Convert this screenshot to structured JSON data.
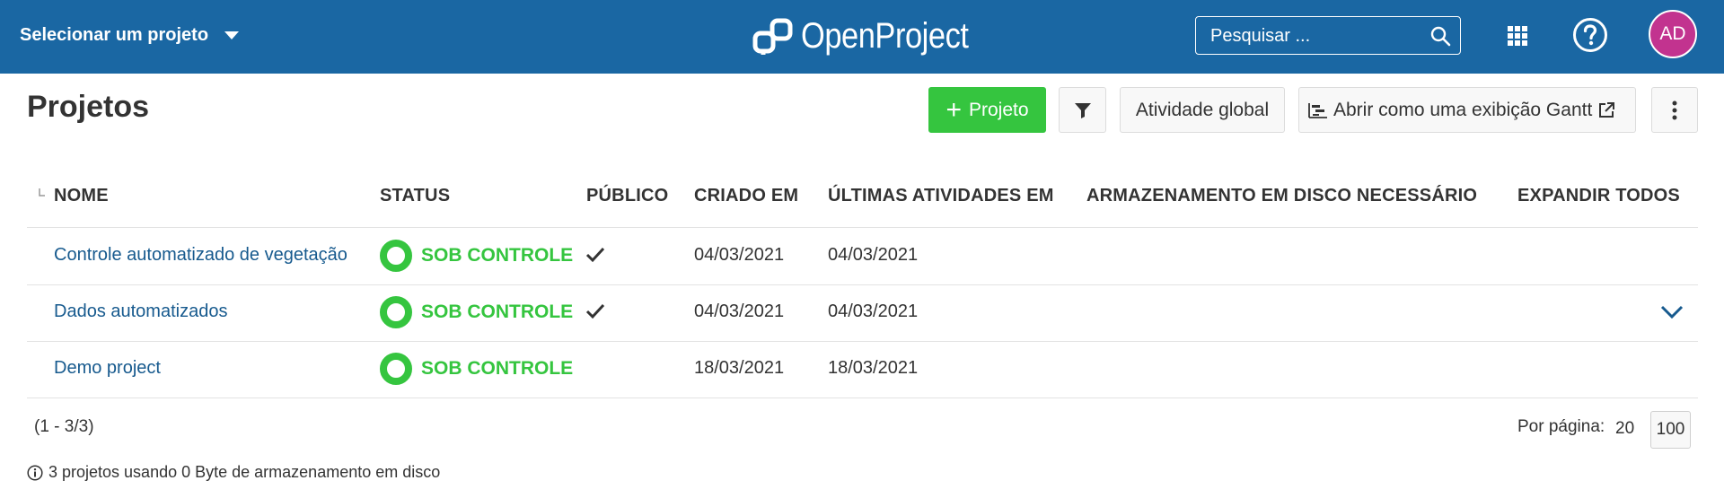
{
  "header": {
    "project_selector": "Selecionar um projeto",
    "logo_text": "OpenProject",
    "search_placeholder": "Pesquisar ...",
    "avatar_initials": "AD",
    "avatar_color": "#c2338f",
    "bar_color": "#1a67a3"
  },
  "page": {
    "title": "Projetos"
  },
  "toolbar": {
    "new_project_label": "Projeto",
    "activity_label": "Atividade global",
    "gantt_label": "Abrir como uma exibição Gantt",
    "accent_color": "#35c53f"
  },
  "table": {
    "columns": [
      "NOME",
      "STATUS",
      "PÚBLICO",
      "CRIADO EM",
      "ÚLTIMAS ATIVIDADES EM",
      "ARMAZENAMENTO EM DISCO NECESSÁRIO",
      "EXPANDIR TODOS"
    ],
    "rows": [
      {
        "name": "Controle automatizado de vegetação",
        "status": "SOB CONTROLE",
        "public": true,
        "created": "04/03/2021",
        "last_activity": "04/03/2021",
        "expandable": false
      },
      {
        "name": "Dados automatizados",
        "status": "SOB CONTROLE",
        "public": true,
        "created": "04/03/2021",
        "last_activity": "04/03/2021",
        "expandable": true
      },
      {
        "name": "Demo project",
        "status": "SOB CONTROLE",
        "public": false,
        "created": "18/03/2021",
        "last_activity": "18/03/2021",
        "expandable": false
      }
    ]
  },
  "footer": {
    "range": "(1 - 3/3)",
    "per_page_label": "Por página:",
    "per_page_options": [
      "20",
      "100"
    ],
    "disk_note": "3 projetos usando 0 Byte de armazenamento em disco"
  },
  "icons": [
    "caret-down-icon",
    "openproject-logo-icon",
    "search-icon",
    "grid-icon",
    "help-icon",
    "plus-icon",
    "filter-icon",
    "gantt-icon",
    "external-link-icon",
    "more-vertical-icon",
    "hierarchy-icon",
    "check-icon",
    "chevron-down-icon",
    "info-icon"
  ]
}
